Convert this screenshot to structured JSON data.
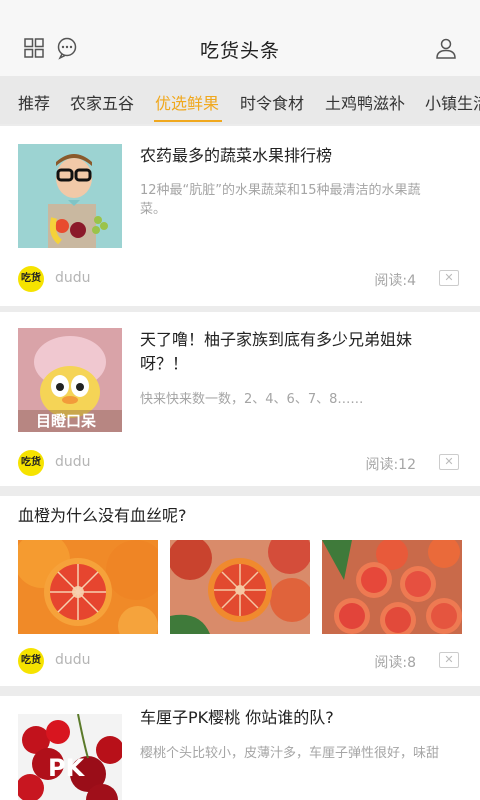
{
  "header": {
    "title": "吃货头条",
    "icons": [
      "grid-icon",
      "chat-icon",
      "user-icon"
    ]
  },
  "tabs": [
    {
      "label": "推荐"
    },
    {
      "label": "农家五谷"
    },
    {
      "label": "优选鲜果",
      "active": true
    },
    {
      "label": "时令食材"
    },
    {
      "label": "土鸡鸭滋补"
    },
    {
      "label": "小镇生活"
    }
  ],
  "articles": [
    {
      "title": "农药最多的蔬菜水果排行榜",
      "summary": "12种最“肮脏”的水果蔬菜和15种最清洁的水果蔬菜。",
      "author": "dudu",
      "reads": "阅读:4",
      "logo_text": "吃货"
    },
    {
      "title": "天了噜！柚子家族到底有多少兄弟姐妹呀？！",
      "summary": "快来快来数一数，2、4、6、7、8……",
      "image_caption": "目瞪口呆",
      "author": "dudu",
      "reads": "阅读:12",
      "logo_text": "吃货"
    },
    {
      "title": "血橙为什么没有血丝呢?",
      "author": "dudu",
      "reads": "阅读:8",
      "logo_text": "吃货"
    },
    {
      "title": "车厘子PK樱桃 你站谁的队?",
      "summary": "樱桃个头比较小，皮薄汁多，车厘子弹性很好，味甜",
      "image_caption": "PK"
    }
  ],
  "colors": {
    "accent": "#f0a81e",
    "logo_bg": "#f6e300"
  }
}
